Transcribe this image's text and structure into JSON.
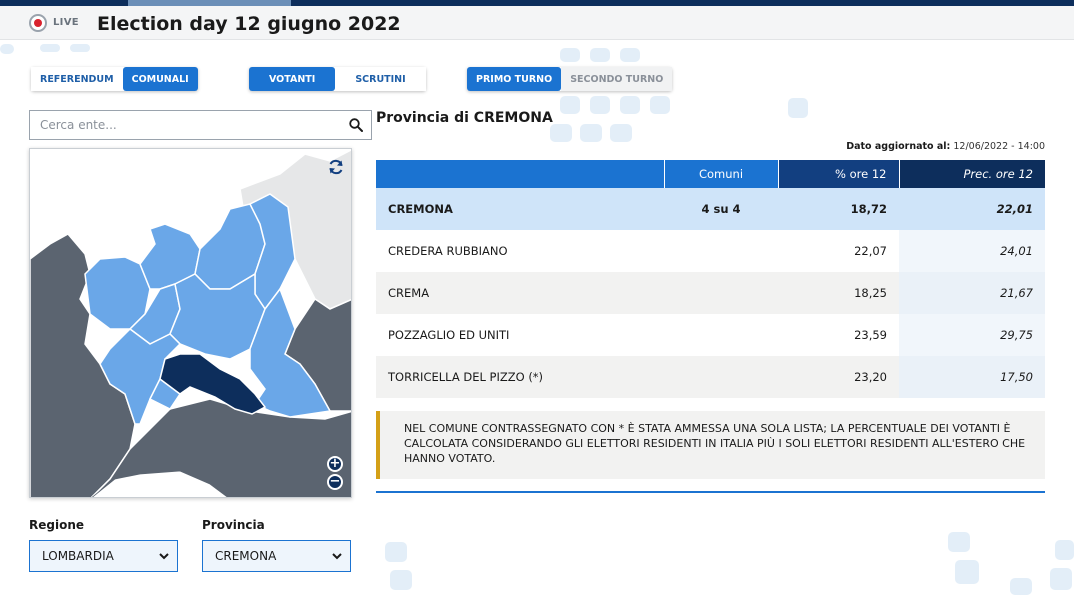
{
  "header": {
    "live_label": "LIVE",
    "title": "Election day 12 giugno 2022"
  },
  "tabs": {
    "type": [
      {
        "label": "REFERENDUM",
        "active": false
      },
      {
        "label": "COMUNALI",
        "active": true
      }
    ],
    "mode": [
      {
        "label": "VOTANTI",
        "active": true
      },
      {
        "label": "SCRUTINI",
        "active": false
      }
    ],
    "round": [
      {
        "label": "PRIMO TURNO",
        "active": true
      },
      {
        "label": "SECONDO TURNO",
        "active": false
      }
    ]
  },
  "search": {
    "placeholder": "Cerca ente...",
    "value": ""
  },
  "province_title": "Provincia di CREMONA",
  "updated": {
    "label": "Dato aggiornato al:",
    "value": "12/06/2022 - 14:00"
  },
  "table": {
    "headers": [
      "",
      "Comuni",
      "% ore 12",
      "Prec. ore 12"
    ],
    "total": {
      "name": "CREMONA",
      "comuni": "4 su 4",
      "pct": "18,72",
      "prev": "22,01"
    },
    "rows": [
      {
        "name": "CREDERA RUBBIANO",
        "pct": "22,07",
        "prev": "24,01"
      },
      {
        "name": "CREMA",
        "pct": "18,25",
        "prev": "21,67"
      },
      {
        "name": "POZZAGLIO ED UNITI",
        "pct": "23,59",
        "prev": "29,75"
      },
      {
        "name": "TORRICELLA DEL PIZZO (*)",
        "pct": "23,20",
        "prev": "17,50"
      }
    ]
  },
  "note": "NEL COMUNE CONTRASSEGNATO CON * È STATA AMMESSA UNA SOLA LISTA; LA PERCENTUALE DEI VOTANTI È CALCOLATA CONSIDERANDO GLI ELETTORI RESIDENTI IN ITALIA PIÙ I SOLI ELETTORI RESIDENTI ALL'ESTERO CHE HANNO VOTATO.",
  "selects": {
    "regione": {
      "label": "Regione",
      "value": "LOMBARDIA"
    },
    "provincia": {
      "label": "Provincia",
      "value": "CREMONA"
    }
  },
  "map": {
    "colors": {
      "region": "#6aa7e8",
      "outside": "#5b6470",
      "selected": "#0d2e5c",
      "foreign": "#e6e7e8"
    },
    "icons": [
      "refresh-icon",
      "zoom-in-icon",
      "zoom-out-icon"
    ]
  }
}
